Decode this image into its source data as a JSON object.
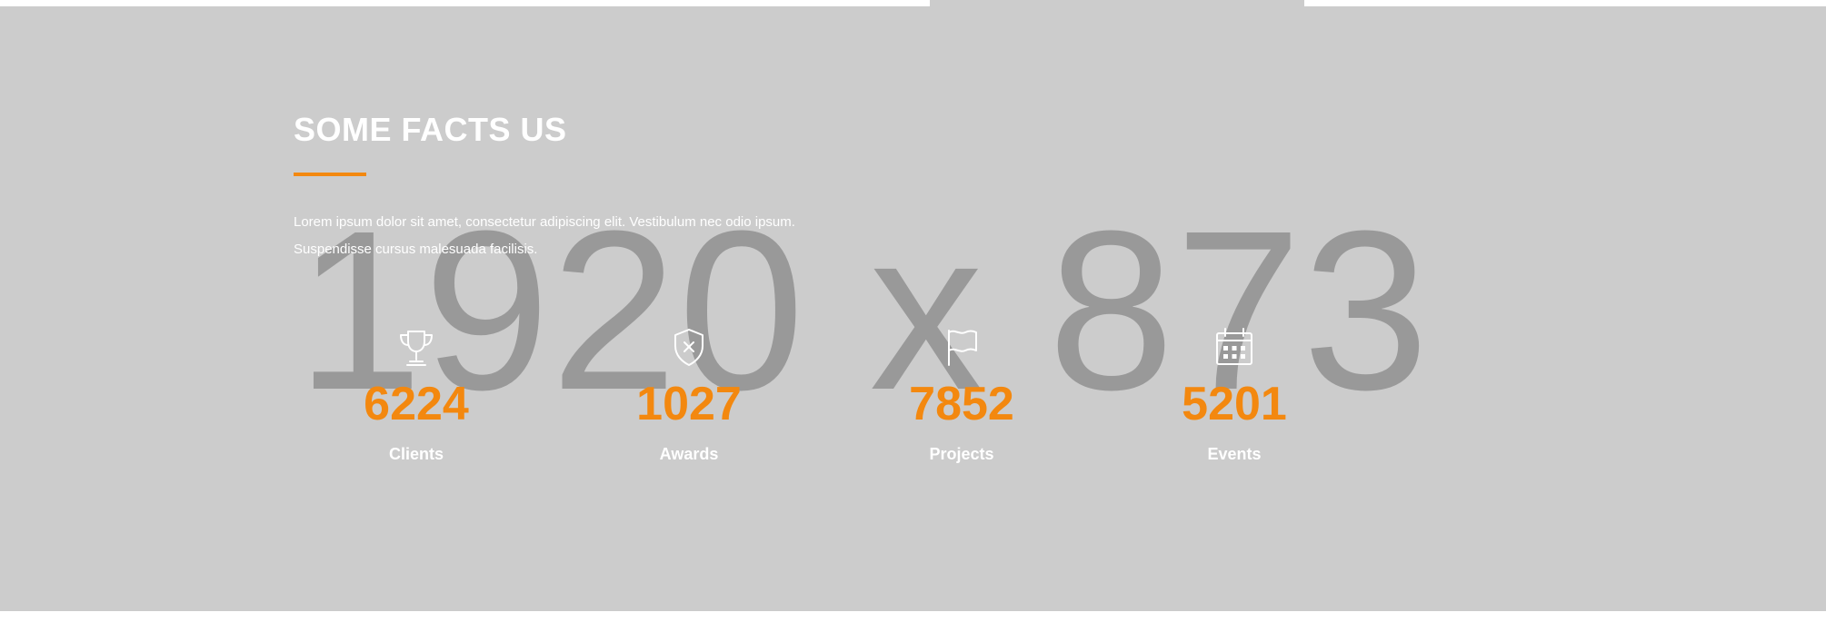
{
  "placeholder": {
    "dimensions": "1920 x 873"
  },
  "facts": {
    "title": "SOME FACTS US",
    "description": "Lorem ipsum dolor sit amet, consectetur adipiscing elit. Vestibulum nec odio ipsum. Suspendisse cursus malesuada facilisis.",
    "accent_color": "#f3880f",
    "items": [
      {
        "icon": "trophy-icon",
        "number": "6224",
        "label": "Clients"
      },
      {
        "icon": "shield-x-icon",
        "number": "1027",
        "label": "Awards"
      },
      {
        "icon": "flag-icon",
        "number": "7852",
        "label": "Projects"
      },
      {
        "icon": "calendar-icon",
        "number": "5201",
        "label": "Events"
      }
    ]
  }
}
